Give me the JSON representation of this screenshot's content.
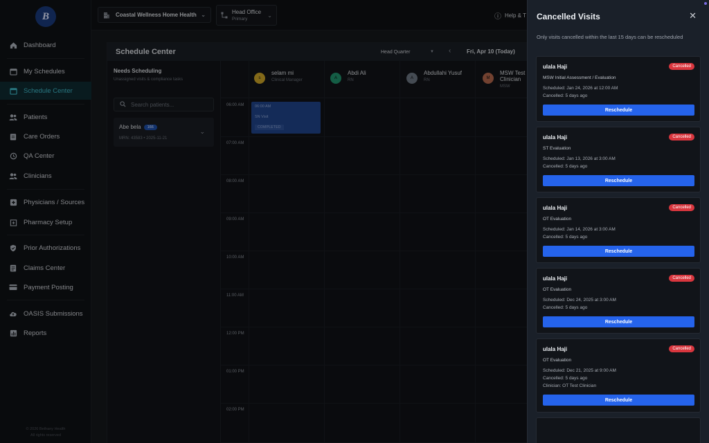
{
  "sidebar": {
    "logo": "B",
    "items": [
      {
        "label": "Dashboard",
        "icon": "home-icon"
      },
      {
        "label": "My Schedules",
        "icon": "calendar-icon"
      },
      {
        "label": "Schedule Center",
        "icon": "calendar-icon",
        "active": true
      },
      {
        "label": "Patients",
        "icon": "users-icon"
      },
      {
        "label": "Care Orders",
        "icon": "clipboard-icon"
      },
      {
        "label": "QA Center",
        "icon": "history-icon"
      },
      {
        "label": "Clinicians",
        "icon": "users-icon"
      },
      {
        "label": "Physicians / Sources",
        "icon": "medical-plus-icon"
      },
      {
        "label": "Pharmacy Setup",
        "icon": "pharmacy-icon"
      },
      {
        "label": "Prior Authorizations",
        "icon": "shield-icon"
      },
      {
        "label": "Claims Center",
        "icon": "document-icon"
      },
      {
        "label": "Payment Posting",
        "icon": "card-icon"
      },
      {
        "label": "OASIS Submissions",
        "icon": "cloud-upload-icon"
      },
      {
        "label": "Reports",
        "icon": "chart-icon"
      }
    ],
    "copyright_line1": "© 2026 Bethany Health",
    "copyright_line2": "All rights reserved"
  },
  "topbar": {
    "org": "Coastal Wellness Home Health",
    "office_name": "Head Office",
    "office_sub": "Primary",
    "help": "Help & T"
  },
  "schedule": {
    "title": "Schedule Center",
    "location": "Head Quarter",
    "date": "Fri, Apr 10 (Today)",
    "needs_title": "Needs Scheduling",
    "needs_sub": "Unassigned visits & compliance tasks",
    "search_placeholder": "Search patients...",
    "patient": {
      "name": "Abe bela",
      "badge": "166",
      "meta": "MRN: 43583  • 2025-11-21"
    },
    "clinicians": [
      {
        "initial": "s",
        "name": "selam mi",
        "role": "Clinical Manager",
        "color": "#c9a227"
      },
      {
        "initial": "A",
        "name": "Abdi Ali",
        "role": "RN",
        "color": "#1f8f6a"
      },
      {
        "initial": "A",
        "name": "Abdullahi Yusuf",
        "role": "RN",
        "color": "#6b7480"
      },
      {
        "initial": "M",
        "name": "MSW Test Clinician",
        "role": "MSW",
        "color": "#b0654a"
      }
    ],
    "times": [
      "06:00 AM",
      "07:00 AM",
      "08:00 AM",
      "09:00 AM",
      "10:00 AM",
      "11:00 AM",
      "12:00 PM",
      "01:00 PM",
      "02:00 PM"
    ],
    "event": {
      "time": "06:00 AM",
      "type": "SN Visit",
      "status": "COMPLETED"
    }
  },
  "drawer": {
    "title": "Cancelled Visits",
    "close": "✕",
    "note": "Only visits cancelled within the last 15 days can be rescheduled",
    "cards": [
      {
        "name": "ulala Haji",
        "badge": "Cancelled",
        "type": "MSW Initial Assessment / Evaluation",
        "scheduled": "Scheduled: Jan 24, 2026 at 12:00 AM",
        "cancelled": "Cancelled: 5 days ago",
        "button": "Reschedule"
      },
      {
        "name": "ulala Haji",
        "badge": "Cancelled",
        "type": "ST Evaluation",
        "scheduled": "Scheduled: Jan 13, 2026 at 3:00 AM",
        "cancelled": "Cancelled: 5 days ago",
        "button": "Reschedule"
      },
      {
        "name": "ulala Haji",
        "badge": "Cancelled",
        "type": "OT Evaluation",
        "scheduled": "Scheduled: Jan 14, 2026 at 3:00 AM",
        "cancelled": "Cancelled: 5 days ago",
        "button": "Reschedule"
      },
      {
        "name": "ulala Haji",
        "badge": "Cancelled",
        "type": "OT Evaluation",
        "scheduled": "Scheduled: Dec 24, 2025 at 3:00 AM",
        "cancelled": "Cancelled: 5 days ago",
        "button": "Reschedule"
      },
      {
        "name": "ulala Haji",
        "badge": "Cancelled",
        "type": "OT Evaluation",
        "scheduled": "Scheduled: Dec 21, 2025 at 9:00 AM",
        "cancelled": "Cancelled: 5 days ago",
        "clinician": "Clinician: OT Test Clinician",
        "button": "Reschedule"
      }
    ]
  }
}
